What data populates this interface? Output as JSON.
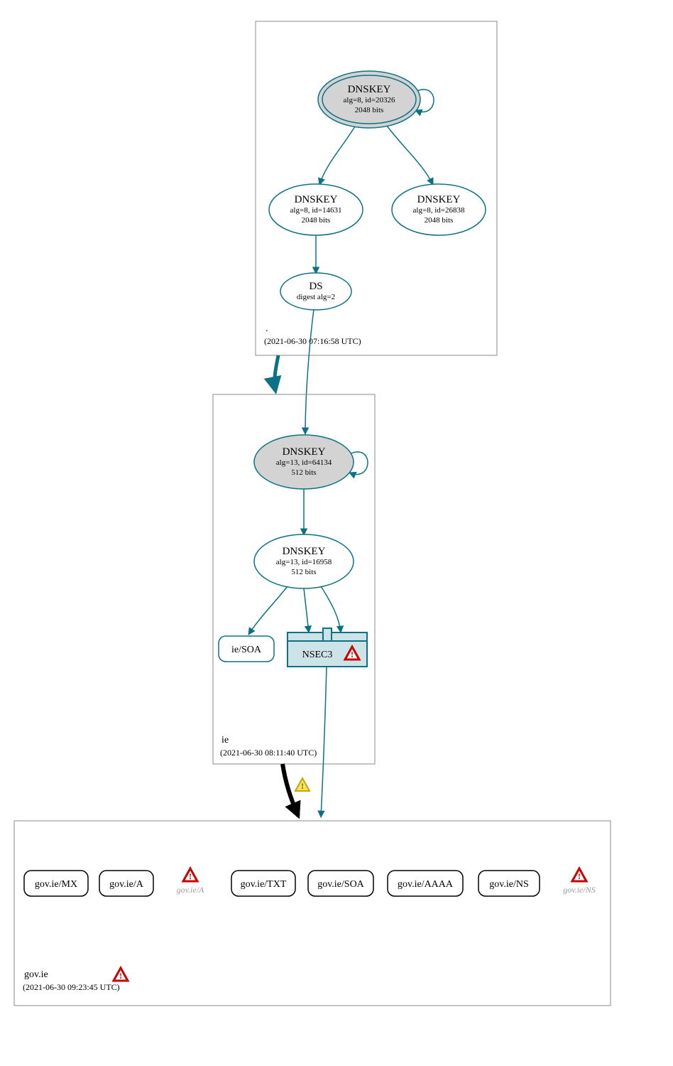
{
  "zones": {
    "root": {
      "name": ".",
      "timestamp": "(2021-06-30 07:16:58 UTC)"
    },
    "ie": {
      "name": "ie",
      "timestamp": "(2021-06-30 08:11:40 UTC)"
    },
    "govie": {
      "name": "gov.ie",
      "timestamp": "(2021-06-30 09:23:45 UTC)"
    }
  },
  "nodes": {
    "root_ksk": {
      "title": "DNSKEY",
      "sub1": "alg=8, id=20326",
      "sub2": "2048 bits"
    },
    "root_zsk1": {
      "title": "DNSKEY",
      "sub1": "alg=8, id=14631",
      "sub2": "2048 bits"
    },
    "root_zsk2": {
      "title": "DNSKEY",
      "sub1": "alg=8, id=26838",
      "sub2": "2048 bits"
    },
    "root_ds": {
      "title": "DS",
      "sub1": "digest alg=2"
    },
    "ie_ksk": {
      "title": "DNSKEY",
      "sub1": "alg=13, id=64134",
      "sub2": "512 bits"
    },
    "ie_zsk": {
      "title": "DNSKEY",
      "sub1": "alg=13, id=16958",
      "sub2": "512 bits"
    },
    "ie_soa": {
      "title": "ie/SOA"
    },
    "ie_nsec3": {
      "title": "NSEC3"
    }
  },
  "records": {
    "r1": "gov.ie/MX",
    "r2": "gov.ie/A",
    "r2g": "gov.ie/A",
    "r3": "gov.ie/TXT",
    "r4": "gov.ie/SOA",
    "r5": "gov.ie/AAAA",
    "r6": "gov.ie/NS",
    "r6g": "gov.ie/NS"
  },
  "colors": {
    "teal": "#0b7285",
    "grey": "#888888",
    "fillgrey": "#d3d3d3",
    "nsecfill": "#cce3e8",
    "black": "#000000",
    "warnYellow": "#f7e463",
    "warnRed": "#cc0000"
  }
}
